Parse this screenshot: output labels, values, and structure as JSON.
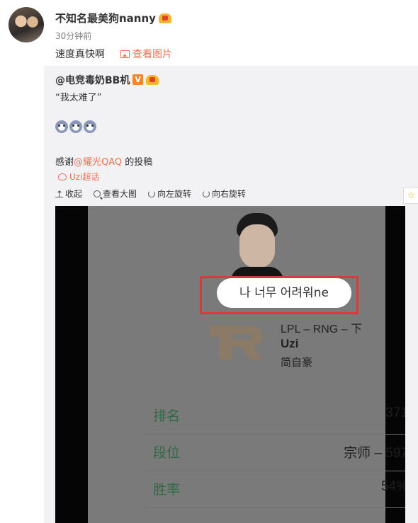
{
  "header": {
    "username": "不知名最美狗nanny",
    "time": "30分钟前",
    "post_text": "速度真快啊",
    "view_image_label": "查看图片"
  },
  "repost": {
    "original_user": "@电竞毒奶BB机",
    "quote": "“我太难了”",
    "thanks_prefix": "感谢",
    "thanks_mention": "@耀光QAQ",
    "thanks_suffix": " 的投稿",
    "topic": "Uzi超话",
    "toolbar": [
      {
        "label": "收起",
        "icon": "collapse-icon"
      },
      {
        "label": "查看大图",
        "icon": "zoom-icon"
      },
      {
        "label": "向左旋转",
        "icon": "rotate-left-icon"
      },
      {
        "label": "向右旋转",
        "icon": "rotate-right-icon"
      }
    ],
    "star": "☆"
  },
  "photo": {
    "bubble_text": "나 너무 어려워ne",
    "team_line": "LPL – RNG – 下",
    "player": "Uzi",
    "player_cn": "简自豪",
    "stats": [
      {
        "label": "排名",
        "value": "371"
      },
      {
        "label": "段位",
        "value": "宗师 – 597"
      },
      {
        "label": "胜率",
        "value": "54%"
      }
    ]
  },
  "colors": {
    "accent": "#eb7350",
    "highlight_box": "#d9393b",
    "stat_label": "#2e6b44"
  }
}
